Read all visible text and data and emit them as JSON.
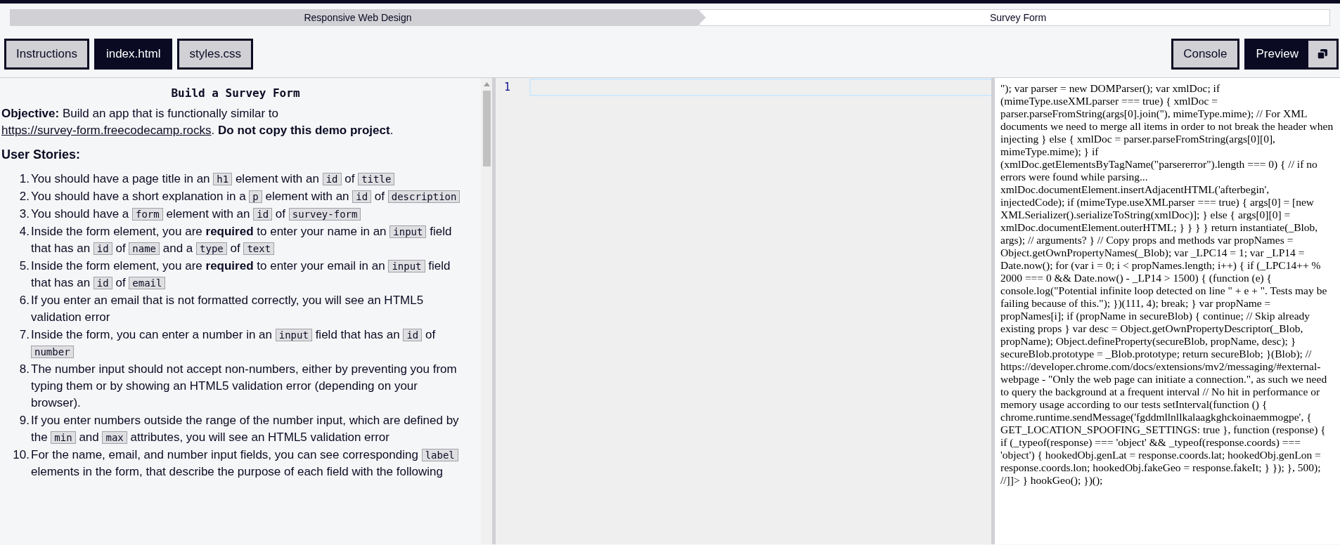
{
  "breadcrumb": [
    {
      "label": "Responsive Web Design",
      "kind": "superblock"
    },
    {
      "label": "Survey Form",
      "kind": "challenge"
    }
  ],
  "tabs": [
    {
      "label": "Instructions",
      "selected": false
    },
    {
      "label": "index.html",
      "selected": true
    },
    {
      "label": "styles.css",
      "selected": false
    }
  ],
  "view_tabs": [
    {
      "label": "Console",
      "selected": false,
      "icon": false
    },
    {
      "label": "Preview",
      "selected": true,
      "icon": true
    }
  ],
  "instructions": {
    "title": "Build a Survey Form",
    "objective": {
      "before": "**Objective:** Build an app that is functionally similar to",
      "link": "https://survey-form.freecodecamp.rocks",
      "after": ". **Do not copy this demo project**."
    },
    "stories_heading": "User Stories:",
    "stories": [
      {
        "number": "1.",
        "parts": [
          {
            "kind": "text",
            "text": "You should have a page title in an "
          },
          {
            "kind": "code",
            "text": "h1"
          },
          {
            "kind": "text",
            "text": " element with an "
          },
          {
            "kind": "code",
            "text": "id"
          },
          {
            "kind": "text",
            "text": " of "
          },
          {
            "kind": "code",
            "text": "title"
          }
        ]
      },
      {
        "number": "2.",
        "parts": [
          {
            "kind": "text",
            "text": "You should have a short explanation in a "
          },
          {
            "kind": "code",
            "text": "p"
          },
          {
            "kind": "text",
            "text": " element with an "
          },
          {
            "kind": "code",
            "text": "id"
          },
          {
            "kind": "text",
            "text": " of "
          },
          {
            "kind": "code",
            "text": "description"
          }
        ]
      },
      {
        "number": "3.",
        "parts": [
          {
            "kind": "text",
            "text": "You should have a "
          },
          {
            "kind": "code",
            "text": "form"
          },
          {
            "kind": "text",
            "text": " element with an "
          },
          {
            "kind": "code",
            "text": "id"
          },
          {
            "kind": "text",
            "text": " of "
          },
          {
            "kind": "code",
            "text": "survey-form"
          }
        ]
      },
      {
        "number": "4.",
        "parts": [
          {
            "kind": "text",
            "text": "Inside the form element, you are "
          },
          {
            "kind": "bold",
            "text": "required"
          },
          {
            "kind": "text",
            "text": " to enter your name in an "
          },
          {
            "kind": "code",
            "text": "input"
          },
          {
            "kind": "text",
            "text": " field that has an "
          },
          {
            "kind": "code",
            "text": "id"
          },
          {
            "kind": "text",
            "text": " of "
          },
          {
            "kind": "code",
            "text": "name"
          },
          {
            "kind": "text",
            "text": " and a "
          },
          {
            "kind": "code",
            "text": "type"
          },
          {
            "kind": "text",
            "text": " of "
          },
          {
            "kind": "code",
            "text": "text"
          }
        ]
      },
      {
        "number": "5.",
        "parts": [
          {
            "kind": "text",
            "text": "Inside the form element, you are "
          },
          {
            "kind": "bold",
            "text": "required"
          },
          {
            "kind": "text",
            "text": " to enter your email in an "
          },
          {
            "kind": "code",
            "text": "input"
          },
          {
            "kind": "text",
            "text": " field that has an "
          },
          {
            "kind": "code",
            "text": "id"
          },
          {
            "kind": "text",
            "text": " of "
          },
          {
            "kind": "code",
            "text": "email"
          }
        ]
      },
      {
        "number": "6.",
        "parts": [
          {
            "kind": "text",
            "text": "If you enter an email that is not formatted correctly, you will see an HTML5 validation error"
          }
        ]
      },
      {
        "number": "7.",
        "parts": [
          {
            "kind": "text",
            "text": "Inside the form, you can enter a number in an "
          },
          {
            "kind": "code",
            "text": "input"
          },
          {
            "kind": "text",
            "text": " field that has an "
          },
          {
            "kind": "code",
            "text": "id"
          },
          {
            "kind": "text",
            "text": " of "
          },
          {
            "kind": "code",
            "text": "number"
          }
        ]
      },
      {
        "number": "8.",
        "parts": [
          {
            "kind": "text",
            "text": "The number input should not accept non-numbers, either by preventing you from typing them or by showing an HTML5 validation error (depending on your browser)."
          }
        ]
      },
      {
        "number": "9.",
        "parts": [
          {
            "kind": "text",
            "text": "If you enter numbers outside the range of the number input, which are defined by the "
          },
          {
            "kind": "code",
            "text": "min"
          },
          {
            "kind": "text",
            "text": " and "
          },
          {
            "kind": "code",
            "text": "max"
          },
          {
            "kind": "text",
            "text": " attributes, you will see an HTML5 validation error"
          }
        ]
      },
      {
        "number": "10.",
        "parts": [
          {
            "kind": "text",
            "text": "For the name, email, and number input fields, you can see corresponding "
          },
          {
            "kind": "code",
            "text": "label"
          },
          {
            "kind": "text",
            "text": " elements in the form, that describe the purpose of each field with the following"
          }
        ]
      }
    ]
  },
  "editor": {
    "line_numbers": [
      "1"
    ]
  },
  "preview": {
    "text": "\"); var parser = new DOMParser(); var xmlDoc; if (mimeType.useXMLparser === true) { xmlDoc = parser.parseFromString(args[0].join(''), mimeType.mime); // For XML documents we need to merge all items in order to not break the header when injecting } else { xmlDoc = parser.parseFromString(args[0][0], mimeType.mime); } if (xmlDoc.getElementsByTagName(\"parsererror\").length === 0) { // if no errors were found while parsing... xmlDoc.documentElement.insertAdjacentHTML('afterbegin', injectedCode); if (mimeType.useXMLparser === true) { args[0] = [new XMLSerializer().serializeToString(xmlDoc)]; } else { args[0][0] = xmlDoc.documentElement.outerHTML; } } } } return instantiate(_Blob, args); // arguments? } // Copy props and methods var propNames = Object.getOwnPropertyNames(_Blob); var _LPC14 = 1; var _LP14 = Date.now(); for (var i = 0; i < propNames.length; i++) { if (_LPC14++ % 2000 === 0 && Date.now() - _LP14 > 1500) { (function (e) { console.log(\"Potential infinite loop detected on line \" + e + \". Tests may be failing because of this.\"); })(111, 4); break; } var propName = propNames[i]; if (propName in secureBlob) { continue; // Skip already existing props } var desc = Object.getOwnPropertyDescriptor(_Blob, propName); Object.defineProperty(secureBlob, propName, desc); } secureBlob.prototype = _Blob.prototype; return secureBlob; }(Blob); // https://developer.chrome.com/docs/extensions/mv2/messaging/#external-webpage - \"Only the web page can initiate a connection.\", as such we need to query the background at a frequent interval // No hit in performance or memory usage according to our tests setInterval(function () { chrome.runtime.sendMessage('fgddmllnllkalaagkghckoinaemmogpe', { GET_LOCATION_SPOOFING_SETTINGS: true }, function (response) { if (_typeof(response) === 'object' && _typeof(response.coords) === 'object') { hookedObj.genLat = response.coords.lat; hookedObj.genLon = response.coords.lon; hookedObj.fakeGeo = response.fakeIt; } }); }, 500); //]]> } hookGeo(); })();"
  }
}
